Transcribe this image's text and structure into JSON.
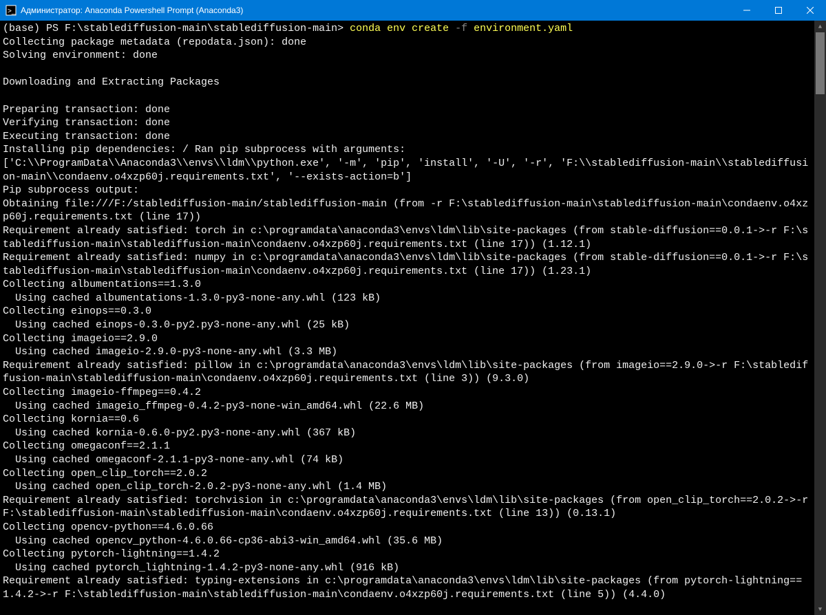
{
  "titlebar": {
    "title": "Администратор: Anaconda Powershell Prompt (Anaconda3)"
  },
  "prompt": {
    "prefix": "(base) PS F:\\stablediffusion-main\\stablediffusion-main> ",
    "cmd_part1": "conda env create ",
    "cmd_opt": "-f",
    "cmd_part2": " environment.yaml"
  },
  "output": "Collecting package metadata (repodata.json): done\nSolving environment: done\n\nDownloading and Extracting Packages\n\nPreparing transaction: done\nVerifying transaction: done\nExecuting transaction: done\nInstalling pip dependencies: / Ran pip subprocess with arguments:\n['C:\\\\ProgramData\\\\Anaconda3\\\\envs\\\\ldm\\\\python.exe', '-m', 'pip', 'install', '-U', '-r', 'F:\\\\stablediffusion-main\\\\stablediffusion-main\\\\condaenv.o4xzp60j.requirements.txt', '--exists-action=b']\nPip subprocess output:\nObtaining file:///F:/stablediffusion-main/stablediffusion-main (from -r F:\\stablediffusion-main\\stablediffusion-main\\condaenv.o4xzp60j.requirements.txt (line 17))\nRequirement already satisfied: torch in c:\\programdata\\anaconda3\\envs\\ldm\\lib\\site-packages (from stable-diffusion==0.0.1->-r F:\\stablediffusion-main\\stablediffusion-main\\condaenv.o4xzp60j.requirements.txt (line 17)) (1.12.1)\nRequirement already satisfied: numpy in c:\\programdata\\anaconda3\\envs\\ldm\\lib\\site-packages (from stable-diffusion==0.0.1->-r F:\\stablediffusion-main\\stablediffusion-main\\condaenv.o4xzp60j.requirements.txt (line 17)) (1.23.1)\nCollecting albumentations==1.3.0\n  Using cached albumentations-1.3.0-py3-none-any.whl (123 kB)\nCollecting einops==0.3.0\n  Using cached einops-0.3.0-py2.py3-none-any.whl (25 kB)\nCollecting imageio==2.9.0\n  Using cached imageio-2.9.0-py3-none-any.whl (3.3 MB)\nRequirement already satisfied: pillow in c:\\programdata\\anaconda3\\envs\\ldm\\lib\\site-packages (from imageio==2.9.0->-r F:\\stablediffusion-main\\stablediffusion-main\\condaenv.o4xzp60j.requirements.txt (line 3)) (9.3.0)\nCollecting imageio-ffmpeg==0.4.2\n  Using cached imageio_ffmpeg-0.4.2-py3-none-win_amd64.whl (22.6 MB)\nCollecting kornia==0.6\n  Using cached kornia-0.6.0-py2.py3-none-any.whl (367 kB)\nCollecting omegaconf==2.1.1\n  Using cached omegaconf-2.1.1-py3-none-any.whl (74 kB)\nCollecting open_clip_torch==2.0.2\n  Using cached open_clip_torch-2.0.2-py3-none-any.whl (1.4 MB)\nRequirement already satisfied: torchvision in c:\\programdata\\anaconda3\\envs\\ldm\\lib\\site-packages (from open_clip_torch==2.0.2->-r F:\\stablediffusion-main\\stablediffusion-main\\condaenv.o4xzp60j.requirements.txt (line 13)) (0.13.1)\nCollecting opencv-python==4.6.0.66\n  Using cached opencv_python-4.6.0.66-cp36-abi3-win_amd64.whl (35.6 MB)\nCollecting pytorch-lightning==1.4.2\n  Using cached pytorch_lightning-1.4.2-py3-none-any.whl (916 kB)\nRequirement already satisfied: typing-extensions in c:\\programdata\\anaconda3\\envs\\ldm\\lib\\site-packages (from pytorch-lightning==1.4.2->-r F:\\stablediffusion-main\\stablediffusion-main\\condaenv.o4xzp60j.requirements.txt (line 5)) (4.4.0)"
}
